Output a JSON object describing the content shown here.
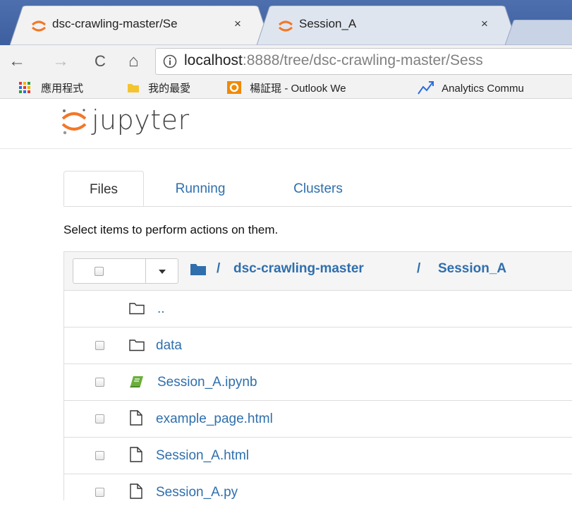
{
  "browser": {
    "tabs": [
      {
        "title": "dsc-crawling-master/Se",
        "close": "×",
        "active": true
      },
      {
        "title": "Session_A",
        "close": "×",
        "active": false
      }
    ],
    "nav": {
      "back": "←",
      "forward": "→",
      "reload": "C",
      "home": "⌂"
    },
    "url": {
      "host": "localhost",
      "path": ":8888/tree/dsc-crawling-master/Sess"
    },
    "bookmarks": [
      {
        "label": "應用程式",
        "icon": "apps-grid-icon"
      },
      {
        "label": "我的最愛",
        "icon": "folder-icon"
      },
      {
        "label": "楊証琨 - Outlook We",
        "icon": "outlook-icon"
      },
      {
        "label": "Analytics Commu",
        "icon": "analytics-icon"
      }
    ]
  },
  "jupyter": {
    "logo_text": "jupyter",
    "tabs": [
      {
        "label": "Files",
        "active": true
      },
      {
        "label": "Running",
        "active": false
      },
      {
        "label": "Clusters",
        "active": false
      }
    ],
    "hint": "Select items to perform actions on them.",
    "breadcrumb": {
      "sep": "/",
      "items": [
        "dsc-crawling-master",
        "Session_A"
      ]
    },
    "rows": [
      {
        "name": "..",
        "icon": "folder-icon",
        "checkbox": false
      },
      {
        "name": "data",
        "icon": "folder-icon",
        "checkbox": true
      },
      {
        "name": "Session_A.ipynb",
        "icon": "notebook-icon",
        "checkbox": true
      },
      {
        "name": "example_page.html",
        "icon": "file-icon",
        "checkbox": true
      },
      {
        "name": "Session_A.html",
        "icon": "file-icon",
        "checkbox": true
      },
      {
        "name": "Session_A.py",
        "icon": "file-icon",
        "checkbox": true
      }
    ]
  },
  "colors": {
    "link": "#2f6fad",
    "tabstrip": "#4d6fae",
    "jupyter_orange": "#f37726",
    "notebook_green": "#6aaf3c"
  }
}
